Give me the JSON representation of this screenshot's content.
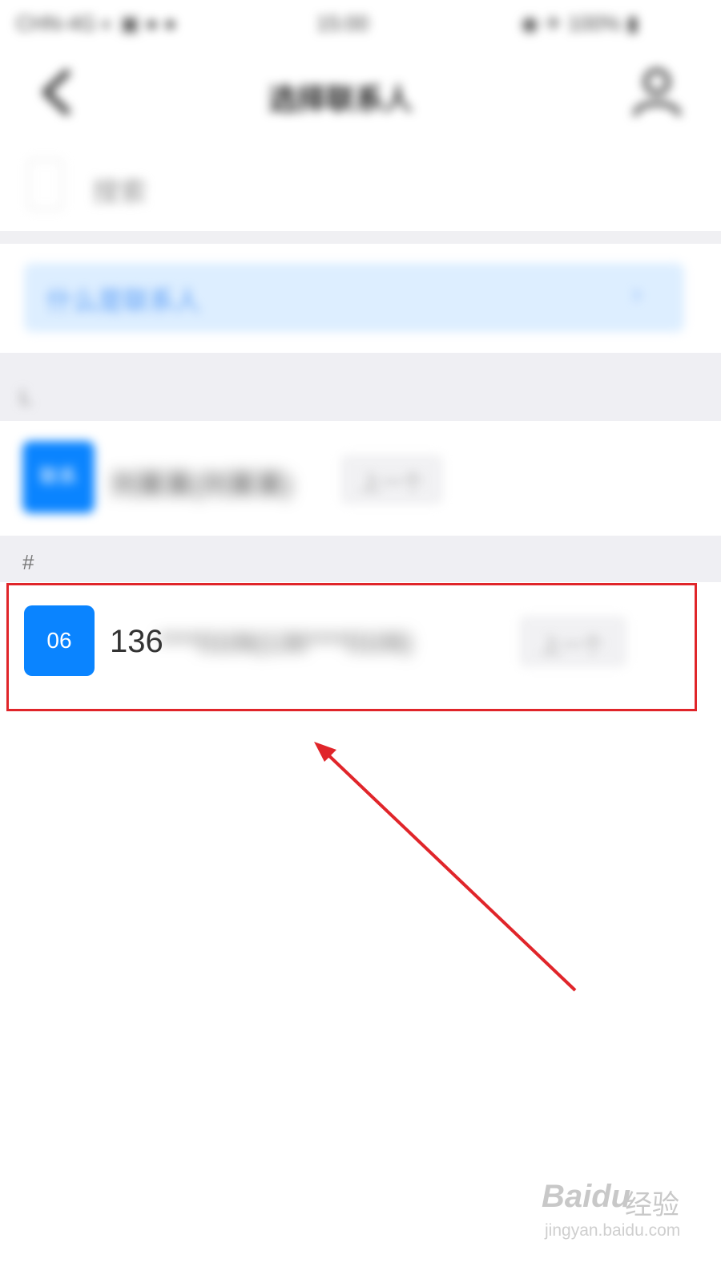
{
  "status_bar": {
    "left": "CHN-4G ◐ ▣ ● ●",
    "time": "15:00",
    "right": "◉ ✈ 100% ▮"
  },
  "header": {
    "title": "选择联系人",
    "back_icon": "chevron-left-icon",
    "contacts_icon": "add-person-icon"
  },
  "search": {
    "placeholder": "搜索"
  },
  "info_banner": {
    "text": "什么是联系人",
    "icon": "chevron-right-icon"
  },
  "sections": [
    {
      "label": "L"
    },
    {
      "label": "#"
    }
  ],
  "contacts": [
    {
      "avatar": "联系",
      "name": "刘某某(刘某某)",
      "badge": "上一个"
    },
    {
      "avatar": "06",
      "name_visible": "136",
      "name_blurred": "****0106(136****0106)",
      "badge": "上一个"
    }
  ],
  "annotation": {
    "highlight_color": "#e0252a",
    "arrow_color": "#e0252a"
  },
  "watermark": {
    "logo": "Baidu",
    "cn": "经验",
    "url": "jingyan.baidu.com"
  },
  "colors": {
    "accent": "#0a84ff",
    "banner_bg": "#ddeeff",
    "section_bg": "#efeff3"
  }
}
